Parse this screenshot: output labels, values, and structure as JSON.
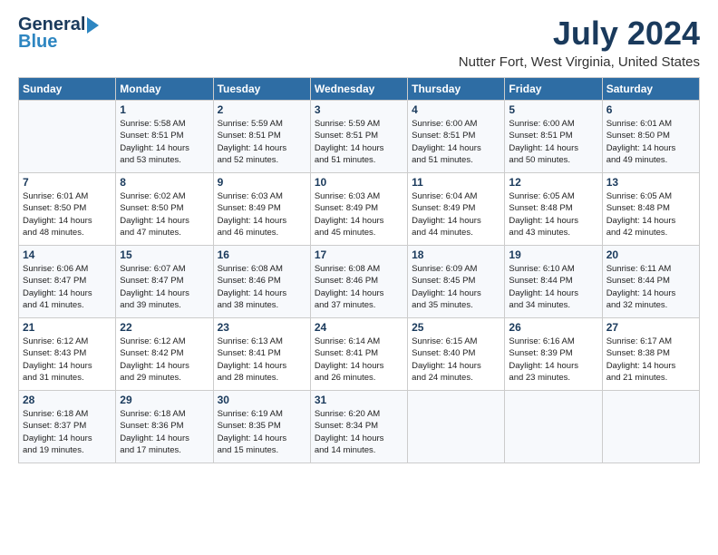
{
  "header": {
    "logo_line1": "General",
    "logo_line2": "Blue",
    "main_title": "July 2024",
    "subtitle": "Nutter Fort, West Virginia, United States"
  },
  "columns": [
    "Sunday",
    "Monday",
    "Tuesday",
    "Wednesday",
    "Thursday",
    "Friday",
    "Saturday"
  ],
  "weeks": [
    [
      {
        "day": "",
        "lines": []
      },
      {
        "day": "1",
        "lines": [
          "Sunrise: 5:58 AM",
          "Sunset: 8:51 PM",
          "Daylight: 14 hours",
          "and 53 minutes."
        ]
      },
      {
        "day": "2",
        "lines": [
          "Sunrise: 5:59 AM",
          "Sunset: 8:51 PM",
          "Daylight: 14 hours",
          "and 52 minutes."
        ]
      },
      {
        "day": "3",
        "lines": [
          "Sunrise: 5:59 AM",
          "Sunset: 8:51 PM",
          "Daylight: 14 hours",
          "and 51 minutes."
        ]
      },
      {
        "day": "4",
        "lines": [
          "Sunrise: 6:00 AM",
          "Sunset: 8:51 PM",
          "Daylight: 14 hours",
          "and 51 minutes."
        ]
      },
      {
        "day": "5",
        "lines": [
          "Sunrise: 6:00 AM",
          "Sunset: 8:51 PM",
          "Daylight: 14 hours",
          "and 50 minutes."
        ]
      },
      {
        "day": "6",
        "lines": [
          "Sunrise: 6:01 AM",
          "Sunset: 8:50 PM",
          "Daylight: 14 hours",
          "and 49 minutes."
        ]
      }
    ],
    [
      {
        "day": "7",
        "lines": [
          "Sunrise: 6:01 AM",
          "Sunset: 8:50 PM",
          "Daylight: 14 hours",
          "and 48 minutes."
        ]
      },
      {
        "day": "8",
        "lines": [
          "Sunrise: 6:02 AM",
          "Sunset: 8:50 PM",
          "Daylight: 14 hours",
          "and 47 minutes."
        ]
      },
      {
        "day": "9",
        "lines": [
          "Sunrise: 6:03 AM",
          "Sunset: 8:49 PM",
          "Daylight: 14 hours",
          "and 46 minutes."
        ]
      },
      {
        "day": "10",
        "lines": [
          "Sunrise: 6:03 AM",
          "Sunset: 8:49 PM",
          "Daylight: 14 hours",
          "and 45 minutes."
        ]
      },
      {
        "day": "11",
        "lines": [
          "Sunrise: 6:04 AM",
          "Sunset: 8:49 PM",
          "Daylight: 14 hours",
          "and 44 minutes."
        ]
      },
      {
        "day": "12",
        "lines": [
          "Sunrise: 6:05 AM",
          "Sunset: 8:48 PM",
          "Daylight: 14 hours",
          "and 43 minutes."
        ]
      },
      {
        "day": "13",
        "lines": [
          "Sunrise: 6:05 AM",
          "Sunset: 8:48 PM",
          "Daylight: 14 hours",
          "and 42 minutes."
        ]
      }
    ],
    [
      {
        "day": "14",
        "lines": [
          "Sunrise: 6:06 AM",
          "Sunset: 8:47 PM",
          "Daylight: 14 hours",
          "and 41 minutes."
        ]
      },
      {
        "day": "15",
        "lines": [
          "Sunrise: 6:07 AM",
          "Sunset: 8:47 PM",
          "Daylight: 14 hours",
          "and 39 minutes."
        ]
      },
      {
        "day": "16",
        "lines": [
          "Sunrise: 6:08 AM",
          "Sunset: 8:46 PM",
          "Daylight: 14 hours",
          "and 38 minutes."
        ]
      },
      {
        "day": "17",
        "lines": [
          "Sunrise: 6:08 AM",
          "Sunset: 8:46 PM",
          "Daylight: 14 hours",
          "and 37 minutes."
        ]
      },
      {
        "day": "18",
        "lines": [
          "Sunrise: 6:09 AM",
          "Sunset: 8:45 PM",
          "Daylight: 14 hours",
          "and 35 minutes."
        ]
      },
      {
        "day": "19",
        "lines": [
          "Sunrise: 6:10 AM",
          "Sunset: 8:44 PM",
          "Daylight: 14 hours",
          "and 34 minutes."
        ]
      },
      {
        "day": "20",
        "lines": [
          "Sunrise: 6:11 AM",
          "Sunset: 8:44 PM",
          "Daylight: 14 hours",
          "and 32 minutes."
        ]
      }
    ],
    [
      {
        "day": "21",
        "lines": [
          "Sunrise: 6:12 AM",
          "Sunset: 8:43 PM",
          "Daylight: 14 hours",
          "and 31 minutes."
        ]
      },
      {
        "day": "22",
        "lines": [
          "Sunrise: 6:12 AM",
          "Sunset: 8:42 PM",
          "Daylight: 14 hours",
          "and 29 minutes."
        ]
      },
      {
        "day": "23",
        "lines": [
          "Sunrise: 6:13 AM",
          "Sunset: 8:41 PM",
          "Daylight: 14 hours",
          "and 28 minutes."
        ]
      },
      {
        "day": "24",
        "lines": [
          "Sunrise: 6:14 AM",
          "Sunset: 8:41 PM",
          "Daylight: 14 hours",
          "and 26 minutes."
        ]
      },
      {
        "day": "25",
        "lines": [
          "Sunrise: 6:15 AM",
          "Sunset: 8:40 PM",
          "Daylight: 14 hours",
          "and 24 minutes."
        ]
      },
      {
        "day": "26",
        "lines": [
          "Sunrise: 6:16 AM",
          "Sunset: 8:39 PM",
          "Daylight: 14 hours",
          "and 23 minutes."
        ]
      },
      {
        "day": "27",
        "lines": [
          "Sunrise: 6:17 AM",
          "Sunset: 8:38 PM",
          "Daylight: 14 hours",
          "and 21 minutes."
        ]
      }
    ],
    [
      {
        "day": "28",
        "lines": [
          "Sunrise: 6:18 AM",
          "Sunset: 8:37 PM",
          "Daylight: 14 hours",
          "and 19 minutes."
        ]
      },
      {
        "day": "29",
        "lines": [
          "Sunrise: 6:18 AM",
          "Sunset: 8:36 PM",
          "Daylight: 14 hours",
          "and 17 minutes."
        ]
      },
      {
        "day": "30",
        "lines": [
          "Sunrise: 6:19 AM",
          "Sunset: 8:35 PM",
          "Daylight: 14 hours",
          "and 15 minutes."
        ]
      },
      {
        "day": "31",
        "lines": [
          "Sunrise: 6:20 AM",
          "Sunset: 8:34 PM",
          "Daylight: 14 hours",
          "and 14 minutes."
        ]
      },
      {
        "day": "",
        "lines": []
      },
      {
        "day": "",
        "lines": []
      },
      {
        "day": "",
        "lines": []
      }
    ]
  ]
}
